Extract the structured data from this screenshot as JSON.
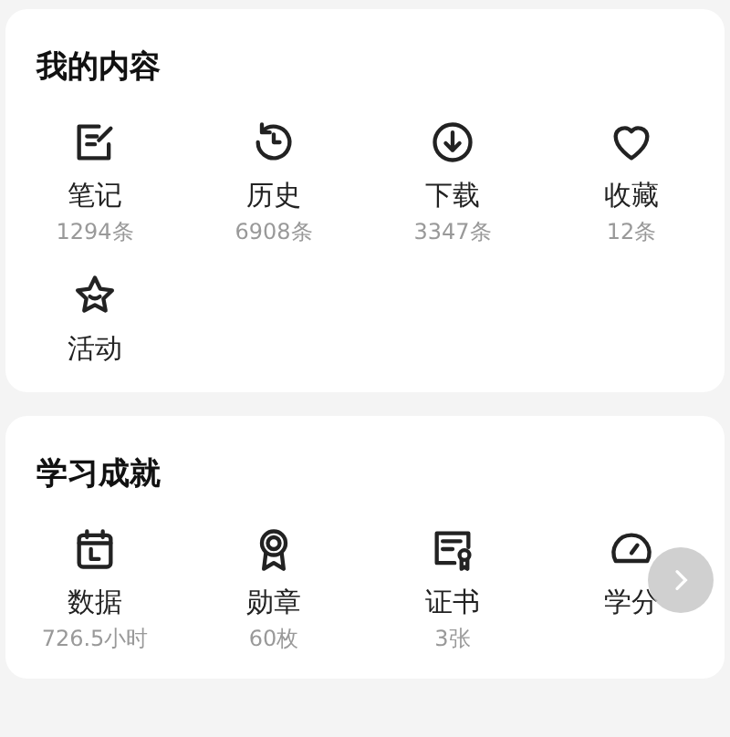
{
  "sections": [
    {
      "title": "我的内容",
      "items": [
        {
          "label": "笔记",
          "count": "1294条"
        },
        {
          "label": "历史",
          "count": "6908条"
        },
        {
          "label": "下载",
          "count": "3347条"
        },
        {
          "label": "收藏",
          "count": "12条"
        },
        {
          "label": "活动"
        }
      ]
    },
    {
      "title": "学习成就",
      "items": [
        {
          "label": "数据",
          "count": "726.5小时"
        },
        {
          "label": "勋章",
          "count": "60枚"
        },
        {
          "label": "证书",
          "count": "3张"
        },
        {
          "label": "学分"
        }
      ],
      "scroll_button": true
    }
  ]
}
